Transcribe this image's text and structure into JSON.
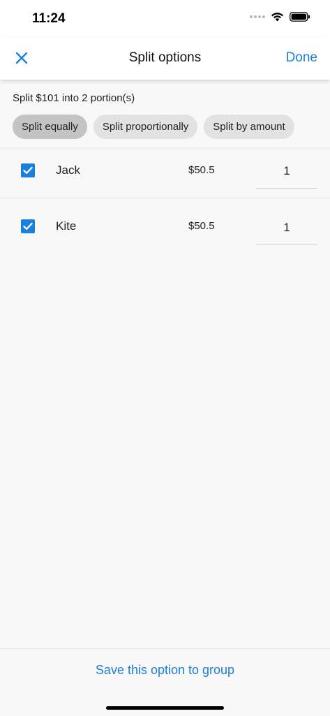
{
  "status_bar": {
    "time": "11:24"
  },
  "nav": {
    "title": "Split options",
    "done_label": "Done",
    "close_icon": "close-icon"
  },
  "summary": "Split $101 into 2 portion(s)",
  "tabs": [
    {
      "label": "Split equally",
      "active": true
    },
    {
      "label": "Split proportionally",
      "active": false
    },
    {
      "label": "Split by amount",
      "active": false
    }
  ],
  "members": [
    {
      "name": "Jack",
      "amount": "$50.5",
      "portion": "1",
      "checked": true
    },
    {
      "name": "Kite",
      "amount": "$50.5",
      "portion": "1",
      "checked": true
    }
  ],
  "footer": {
    "save_label": "Save this option to group"
  },
  "colors": {
    "accent": "#1a7fe0",
    "active_tab": "#c3c3c3",
    "inactive_tab": "#e2e2e2",
    "background": "#f8f8f8"
  }
}
